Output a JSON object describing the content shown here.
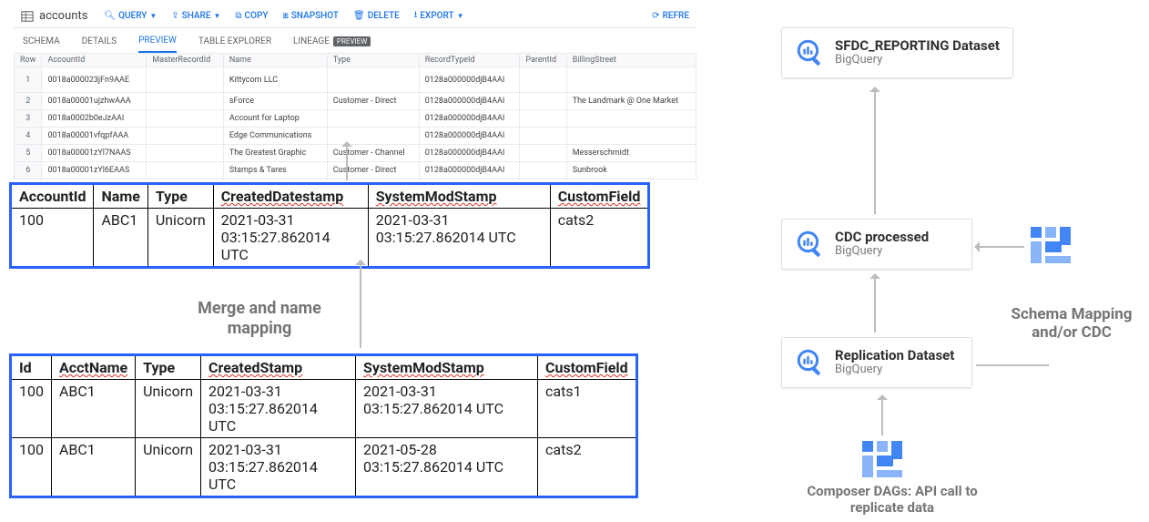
{
  "bq_pane": {
    "title": "accounts",
    "actions": {
      "query": "QUERY",
      "share": "SHARE",
      "copy": "COPY",
      "snapshot": "SNAPSHOT",
      "delete": "DELETE",
      "export": "EXPORT",
      "refresh": "REFRE"
    },
    "tabs": {
      "schema": "SCHEMA",
      "details": "DETAILS",
      "preview": "PREVIEW",
      "table_explorer": "TABLE EXPLORER",
      "lineage": "LINEAGE",
      "preview_badge": "PREVIEW"
    },
    "columns": [
      "Row",
      "AccountId",
      "MasterRecordId",
      "Name",
      "Type",
      "RecordTypeId",
      "ParentId",
      "BillingStreet"
    ],
    "rows": [
      {
        "row": "1",
        "AccountId": "0018a000023jFn9AAE",
        "MasterRecordId": "",
        "Name": "Kittycorn LLC",
        "Type": "",
        "RecordTypeId": "0128a000000djB4AAI",
        "ParentId": "",
        "BillingStreet": ""
      },
      {
        "row": "2",
        "AccountId": "0018a00001ujzhwAAA",
        "MasterRecordId": "",
        "Name": "sForce",
        "Type": "Customer - Direct",
        "RecordTypeId": "0128a000000djB4AAI",
        "ParentId": "",
        "BillingStreet": "The Landmark @ One Market"
      },
      {
        "row": "3",
        "AccountId": "0018a0002b0eJzAAI",
        "MasterRecordId": "",
        "Name": "Account for Laptop",
        "Type": "",
        "RecordTypeId": "0128a000000djB4AAI",
        "ParentId": "",
        "BillingStreet": ""
      },
      {
        "row": "4",
        "AccountId": "0018a00001vfqpfAAA",
        "MasterRecordId": "",
        "Name": "Edge Communications",
        "Type": "",
        "RecordTypeId": "0128a000000djB4AAI",
        "ParentId": "",
        "BillingStreet": ""
      },
      {
        "row": "5",
        "AccountId": "0018a00001zYl7NAAS",
        "MasterRecordId": "",
        "Name": "The Greatest Graphic",
        "Type": "Customer - Channel",
        "RecordTypeId": "0128a000000djB4AAI",
        "ParentId": "",
        "BillingStreet": "Messerschmidt"
      },
      {
        "row": "6",
        "AccountId": "0018a00001zYl6EAAS",
        "MasterRecordId": "",
        "Name": "Stamps & Tares",
        "Type": "Customer - Direct",
        "RecordTypeId": "0128a000000djB4AAI",
        "ParentId": "",
        "BillingStreet": "Sunbrook"
      }
    ]
  },
  "upper_table": {
    "headers": [
      "AccountId",
      "Name",
      "Type",
      "CreatedDatestamp",
      "SystemModStamp",
      "CustomField"
    ],
    "rows": [
      {
        "AccountId": "100",
        "Name": "ABC1",
        "Type": "Unicorn",
        "CreatedDatestamp": "2021-03-31 03:15:27.862014 UTC",
        "SystemModStamp": "2021-03-31 03:15:27.862014 UTC",
        "CustomField": "cats2"
      }
    ]
  },
  "merge_label": "Merge and name mapping",
  "lower_table": {
    "headers": [
      "Id",
      "AcctName",
      "Type",
      "CreatedStamp",
      "SystemModStamp",
      "CustomField"
    ],
    "rows": [
      {
        "Id": "100",
        "AcctName": "ABC1",
        "Type": "Unicorn",
        "CreatedStamp": "2021-03-31 03:15:27.862014 UTC",
        "SystemModStamp": "2021-03-31 03:15:27.862014 UTC",
        "CustomField": "cats1"
      },
      {
        "Id": "100",
        "AcctName": "ABC1",
        "Type": "Unicorn",
        "CreatedStamp": "2021-03-31 03:15:27.862014 UTC",
        "SystemModStamp": "2021-05-28 03:15:27.862014 UTC",
        "CustomField": "cats2"
      }
    ]
  },
  "right_diagram": {
    "sfdc": {
      "title": "SFDC_REPORTING Dataset",
      "sub": "BigQuery"
    },
    "cdc": {
      "title": "CDC processed",
      "sub": "BigQuery"
    },
    "repl": {
      "title": "Replication Dataset",
      "sub": "BigQuery"
    },
    "schema_label": "Schema Mapping and/or CDC",
    "composer_label": "Composer DAGs: API call to replicate data"
  }
}
